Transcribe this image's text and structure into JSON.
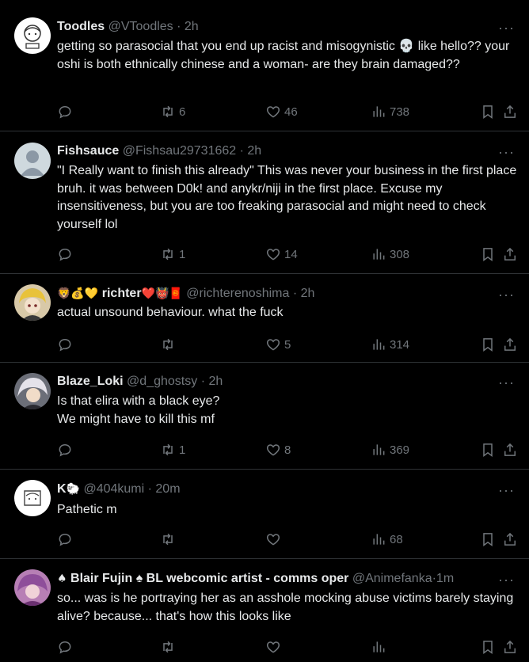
{
  "posts": [
    {
      "name": "Toodles",
      "handle": "@VToodles",
      "sep": "·",
      "time": "2h",
      "text": "getting so parasocial that you end up racist and misogynistic 💀 like hello?? your oshi is both ethnically chinese and a woman- are they brain damaged??",
      "retweets": "6",
      "likes": "46",
      "views": "738"
    },
    {
      "name": "Fishsauce",
      "handle": "@Fishsau29731662",
      "sep": "·",
      "time": "2h",
      "text": "\"I Really want to finish this already\" This was never your business in the first place bruh. it was between D0k! and anykr/niji  in the first place. Excuse my insensitiveness, but you are too freaking parasocial and might need to check yourself lol",
      "retweets": "1",
      "likes": "14",
      "views": "308"
    },
    {
      "name_prefix": "🦁💰💛",
      "name": "richter",
      "name_suffix": "❤️👹🧧",
      "handle": "@richterenoshima",
      "sep": "·",
      "time": "2h",
      "text": "actual unsound behaviour. what the fuck",
      "retweets": "",
      "likes": "5",
      "views": "314"
    },
    {
      "name": "Blaze_Loki",
      "handle": "@d_ghostsy",
      "sep": "·",
      "time": "2h",
      "text": "Is that elira with a black eye?\nWe might have to kill this mf",
      "retweets": "1",
      "likes": "8",
      "views": "369"
    },
    {
      "name": "K",
      "name_suffix": "🐑",
      "handle": "@404kumi",
      "sep": "·",
      "time": "20m",
      "text": "Pathetic m",
      "retweets": "",
      "likes": "",
      "views": "68"
    },
    {
      "name_prefix": "♠",
      "name": "Blair Fujin ♠ BL webcomic artist - comms oper",
      "handle": "@Animefanka",
      "sep": "·",
      "time": "1m",
      "text": "so... was is he portraying her as an asshole mocking abuse victims barely staying alive? because... that's how this looks like",
      "retweets": "",
      "likes": "",
      "views": ""
    }
  ],
  "more_label": "···",
  "colors": {
    "background": "#000000",
    "text": "#e7e9ea",
    "muted": "#71767b",
    "divider": "#2f3336"
  },
  "icons": [
    "reply-icon",
    "retweet-icon",
    "like-icon",
    "views-icon",
    "bookmark-icon",
    "share-icon",
    "more-icon"
  ]
}
